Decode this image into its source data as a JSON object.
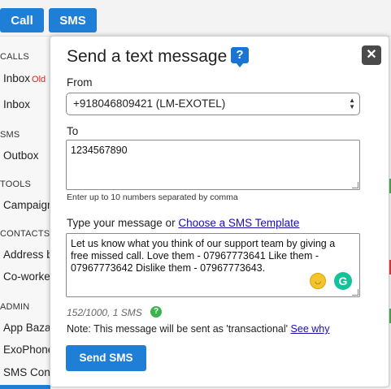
{
  "top_buttons": {
    "call": "Call",
    "sms": "SMS"
  },
  "sidebar": {
    "sections": [
      {
        "label": "CALLS"
      },
      {
        "label": "SMS"
      },
      {
        "label": "TOOLS"
      },
      {
        "label": "CONTACTS"
      },
      {
        "label": "ADMIN"
      }
    ],
    "items": [
      {
        "label": "Inbox",
        "badge": "Old"
      },
      {
        "label": "Inbox"
      },
      {
        "label": "Outbox"
      },
      {
        "label": "Campaign"
      },
      {
        "label": "Address b"
      },
      {
        "label": "Co-worke"
      },
      {
        "label": "App Baza"
      },
      {
        "label": "ExoPhone"
      },
      {
        "label": "SMS Conf"
      }
    ]
  },
  "modal": {
    "title": "Send a text message",
    "help_icon": "?",
    "close_icon": "close-icon",
    "from_label": "From",
    "from_value": "+918046809421 (LM-EXOTEL)",
    "to_label": "To",
    "to_value": "1234567890",
    "to_hint": "Enter up to 10 numbers separated by comma",
    "message_label": "Type your message or",
    "template_link": "Choose a SMS Template",
    "message_value": "Let us know what you think of our support team by giving a free missed call. Love them - 07967773641 Like them - 07967773642 Dislike them - 07967773643.",
    "char_count": "152/1000, 1 SMS",
    "note": "Note: This message will be sent as 'transactional'",
    "note_link": "See why",
    "send_button": "Send SMS"
  },
  "colors": {
    "primary": "#1f7ed6",
    "accent_red": "#e02020",
    "success": "#3cb44b",
    "grammarly": "#15c39a"
  }
}
